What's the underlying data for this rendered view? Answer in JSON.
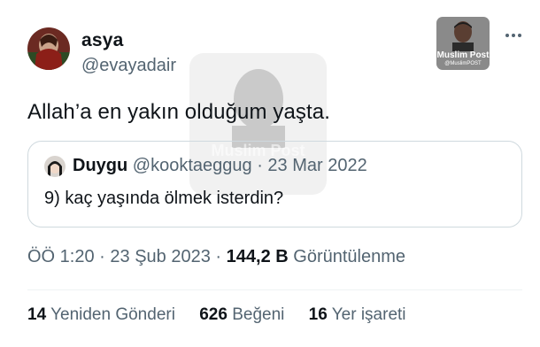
{
  "author": {
    "display_name": "asya",
    "handle": "@evayadair"
  },
  "tweet": {
    "text": "Allah’a en yakın olduğum yaşta."
  },
  "quoted_tweet": {
    "display_name": "Duygu",
    "handle": "@kooktaeggug",
    "separator": "·",
    "date": "23 Mar 2022",
    "text": "9) kaç yaşında ölmek isterdin?"
  },
  "meta": {
    "time": "ÖÖ 1:20",
    "separator": "·",
    "date": "23 Şub 2023",
    "separator2": "·",
    "views_count": "144,2 B",
    "views_label": "Görüntülenme"
  },
  "stats": {
    "retweets_count": "14",
    "retweets_label": "Yeniden Gönderi",
    "likes_count": "626",
    "likes_label": "Beğeni",
    "bookmarks_count": "16",
    "bookmarks_label": "Yer işareti"
  },
  "brand": {
    "title": "Muslim Post",
    "handle": "@MuslimPOST"
  },
  "watermark": {
    "text": "Muslim Post"
  },
  "icons": {
    "more": "more-horizontal-icon"
  },
  "colors": {
    "text_primary": "#0f1419",
    "text_secondary": "#536471",
    "border": "#cfd9de"
  }
}
